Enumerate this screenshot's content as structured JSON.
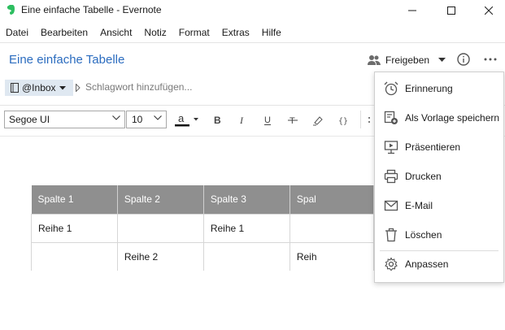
{
  "window": {
    "title": "Eine einfache Tabelle - Evernote",
    "brand_color": "#2dbe60"
  },
  "menubar": {
    "items": [
      "Datei",
      "Bearbeiten",
      "Ansicht",
      "Notiz",
      "Format",
      "Extras",
      "Hilfe"
    ]
  },
  "note": {
    "title": "Eine einfache Tabelle",
    "title_color": "#2b6cbf",
    "share_label": "Freigeben",
    "notebook": "@Inbox",
    "tag_placeholder": "Schlagwort hinzufügen..."
  },
  "toolbar": {
    "font": "Segoe UI",
    "size": "10",
    "buttons": [
      "font-color",
      "bold",
      "italic",
      "underline",
      "strikethrough",
      "highlight",
      "code-block"
    ]
  },
  "table": {
    "headers": [
      "Spalte 1",
      "Spalte 2",
      "Spalte 3",
      "Spal"
    ],
    "rows": [
      [
        "Reihe 1",
        "",
        "Reihe 1",
        ""
      ],
      [
        "",
        "Reihe 2",
        "",
        "Reih"
      ]
    ],
    "header_bg": "#8f8f8f"
  },
  "dropdown": {
    "items": [
      {
        "label": "Erinnerung",
        "icon": "alarm-clock-icon"
      },
      {
        "label": "Als Vorlage speichern",
        "icon": "save-template-icon"
      },
      {
        "label": "Präsentieren",
        "icon": "present-icon"
      },
      {
        "label": "Drucken",
        "icon": "printer-icon"
      },
      {
        "label": "E-Mail",
        "icon": "mail-icon"
      },
      {
        "label": "Löschen",
        "icon": "trash-icon"
      },
      {
        "label": "Anpassen",
        "icon": "gear-icon"
      }
    ]
  }
}
